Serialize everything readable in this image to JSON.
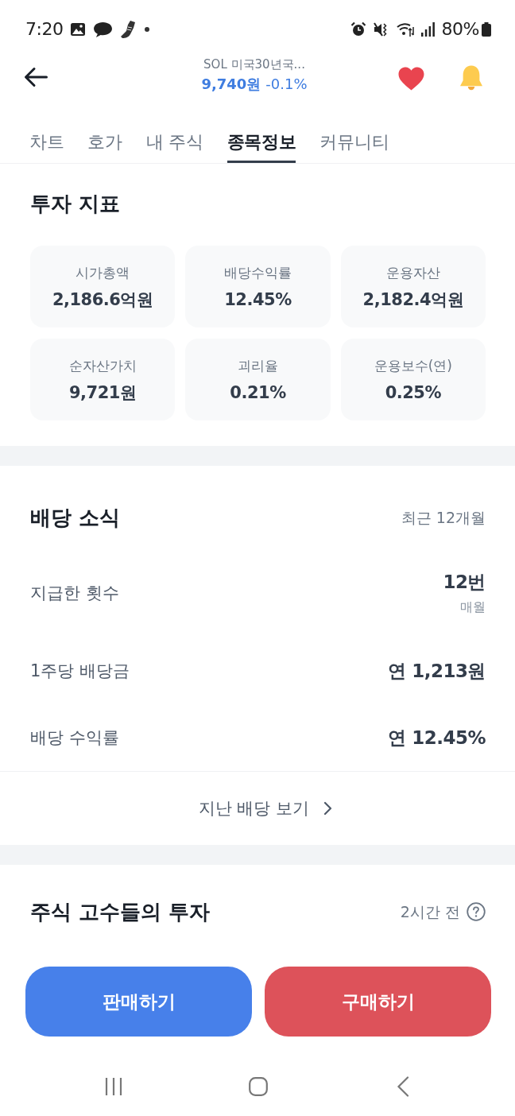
{
  "status_bar": {
    "time": "7:20",
    "battery": "80%"
  },
  "header": {
    "title": "SOL 미국30년국...",
    "price": "9,740원",
    "change": "-0.1%",
    "favorite": true
  },
  "tabs": [
    {
      "label": "차트",
      "selected": false
    },
    {
      "label": "호가",
      "selected": false
    },
    {
      "label": "내 주식",
      "selected": false
    },
    {
      "label": "종목정보",
      "selected": true
    },
    {
      "label": "커뮤니티",
      "selected": false
    }
  ],
  "indicators": {
    "title": "투자 지표",
    "items": [
      {
        "label": "시가총액",
        "value": "2,186.6억원"
      },
      {
        "label": "배당수익률",
        "value": "12.45%"
      },
      {
        "label": "운용자산",
        "value": "2,182.4억원"
      },
      {
        "label": "순자산가치",
        "value": "9,721원"
      },
      {
        "label": "괴리율",
        "value": "0.21%"
      },
      {
        "label": "운용보수(연)",
        "value": "0.25%"
      }
    ]
  },
  "dividends": {
    "title": "배당 소식",
    "period": "최근 12개월",
    "rows": [
      {
        "label": "지급한 횟수",
        "value": "12번",
        "note": "매월"
      },
      {
        "label": "1주당 배당금",
        "value": "연 1,213원"
      },
      {
        "label": "배당 수익률",
        "value": "연 12.45%"
      }
    ],
    "link": "지난 배당 보기"
  },
  "experts": {
    "title": "주식 고수들의 투자",
    "updated": "2시간 전"
  },
  "actions": [
    {
      "label": "판매하기",
      "kind": "sell"
    },
    {
      "label": "구매하기",
      "kind": "buy"
    }
  ]
}
